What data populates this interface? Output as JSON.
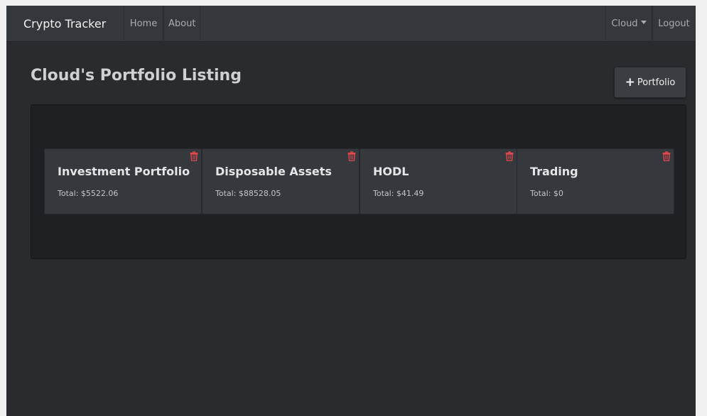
{
  "navbar": {
    "brand": "Crypto Tracker",
    "links": [
      "Home",
      "About"
    ],
    "user_menu": "Cloud",
    "logout": "Logout"
  },
  "header": {
    "title": "Cloud's Portfolio Listing",
    "add_button_label": "Portfolio",
    "add_button_icon": "plus-icon"
  },
  "portfolios": [
    {
      "name": "Investment Portfolio",
      "total": "Total: $5522.06"
    },
    {
      "name": "Disposable Assets",
      "total": "Total: $88528.05"
    },
    {
      "name": "HODL",
      "total": "Total: $41.49"
    },
    {
      "name": "Trading",
      "total": "Total: $0"
    }
  ],
  "icons": {
    "delete": "trash-icon",
    "user_dropdown": "chevron-down-icon"
  },
  "colors": {
    "background": "#2a2b2e",
    "navbar": "#34373b",
    "panel": "#1f2023",
    "card": "#35383c",
    "delete_icon": "#e0474c"
  }
}
